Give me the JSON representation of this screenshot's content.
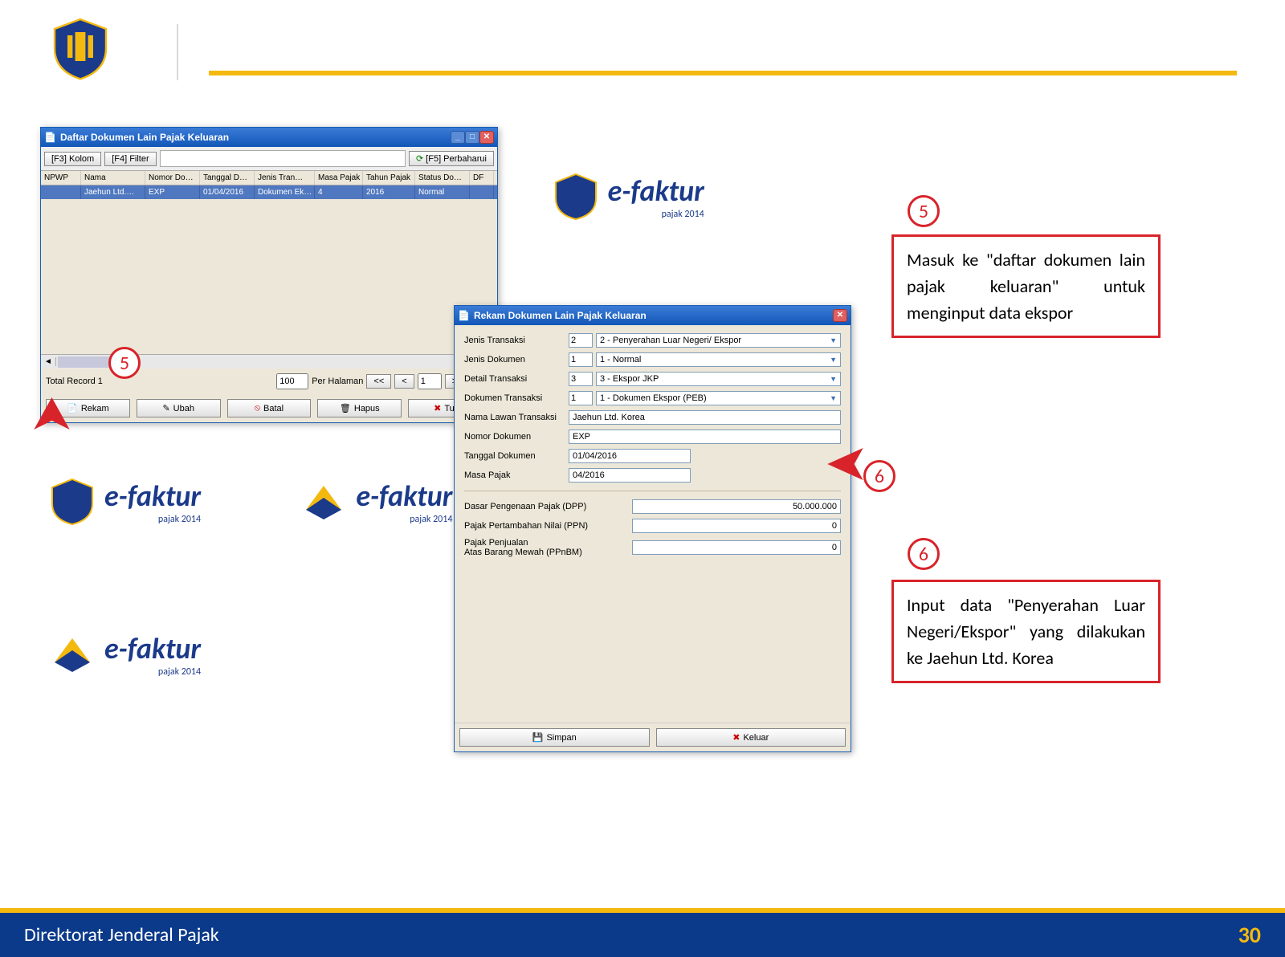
{
  "header": {},
  "footer": {
    "org": "Direktorat Jenderal Pajak",
    "page": "30"
  },
  "bg": {
    "brand": "e-faktur",
    "sub": "pajak 2014"
  },
  "win1": {
    "title": "Daftar Dokumen Lain Pajak Keluaran",
    "btn_kolom": "[F3] Kolom",
    "btn_filter": "[F4] Filter",
    "btn_refresh": "[F5] Perbaharui",
    "cols": {
      "npwp": "NPWP",
      "nama": "Nama",
      "nodok": "Nomor Do…",
      "tgl": "Tanggal D…",
      "jenis": "Jenis Tran…",
      "masa": "Masa Pajak",
      "tahun": "Tahun Pajak",
      "status": "Status Do…",
      "df": "DF"
    },
    "row": {
      "npwp": "",
      "nama": "Jaehun Ltd.…",
      "nodok": "EXP",
      "tgl": "01/04/2016",
      "jenis": "Dokumen Ek…",
      "masa": "4",
      "tahun": "2016",
      "status": "Normal",
      "df": ""
    },
    "total": "Total Record 1",
    "perhal": "100",
    "perhal_lbl": "Per Halaman",
    "pg_first": "<<",
    "pg_prev": "<",
    "pg_cur": "1",
    "pg_next": ">",
    "pg_last": ">>",
    "rekam": "Rekam",
    "ubah": "Ubah",
    "batal": "Batal",
    "hapus": "Hapus",
    "tutup": "Tutup"
  },
  "win2": {
    "title": "Rekam Dokumen Lain Pajak Keluaran",
    "f_jenis_tr": "Jenis Transaksi",
    "v_jenis_tr_idx": "2",
    "v_jenis_tr": "2 - Penyerahan Luar Negeri/ Ekspor",
    "f_jenis_dok": "Jenis Dokumen",
    "v_jenis_dok_idx": "1",
    "v_jenis_dok": "1 - Normal",
    "f_detail": "Detail Transaksi",
    "v_detail_idx": "3",
    "v_detail": "3 - Ekspor JKP",
    "f_doktr": "Dokumen Transaksi",
    "v_doktr_idx": "1",
    "v_doktr": "1 - Dokumen Ekspor (PEB)",
    "f_nama": "Nama Lawan Transaksi",
    "v_nama": "Jaehun Ltd. Korea",
    "f_nomor": "Nomor Dokumen",
    "v_nomor": "EXP",
    "f_tgl": "Tanggal Dokumen",
    "v_tgl": "01/04/2016",
    "f_masa": "Masa Pajak",
    "v_masa": "04/2016",
    "f_dpp": "Dasar Pengenaan Pajak (DPP)",
    "v_dpp": "50.000.000",
    "f_ppn": "Pajak Pertambahan Nilai (PPN)",
    "v_ppn": "0",
    "f_ppnbm": "Pajak Penjualan\nAtas Barang Mewah (PPnBM)",
    "v_ppnbm": "0",
    "simpan": "Simpan",
    "keluar": "Keluar"
  },
  "callout5": {
    "num": "5",
    "text": "Masuk ke \"daftar dokumen lain pajak keluaran\" untuk menginput data ekspor"
  },
  "callout6": {
    "num": "6",
    "text": "Input data \"Penyerahan Luar Negeri/Ekspor\" yang dilakukan ke Jaehun Ltd. Korea"
  },
  "marker5": {
    "num": "5"
  },
  "marker6": {
    "num": "6"
  }
}
